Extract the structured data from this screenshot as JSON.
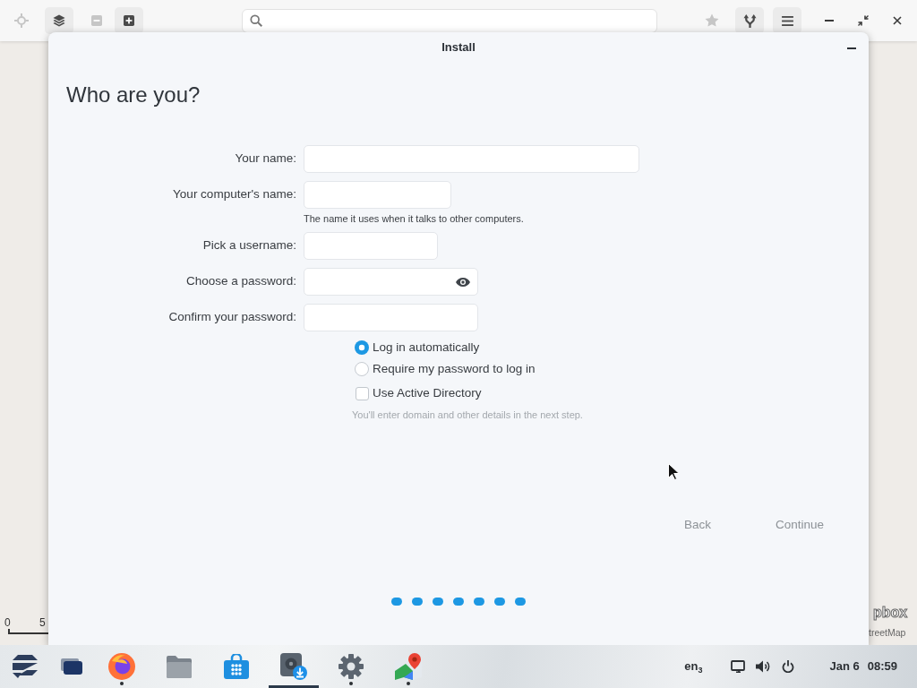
{
  "map_toolbar": {
    "left_buttons": [
      {
        "kind": "locate",
        "disabled": true
      },
      {
        "kind": "layers",
        "disabled": false
      },
      {
        "kind": "zoom-out",
        "disabled": true
      },
      {
        "kind": "zoom-in",
        "disabled": false
      }
    ],
    "right_buttons": [
      {
        "kind": "favorite",
        "disabled": true
      },
      {
        "kind": "route",
        "disabled": false
      },
      {
        "kind": "menu",
        "disabled": false
      }
    ]
  },
  "map": {
    "scale_labels": [
      "0",
      "5"
    ],
    "attribution_logo": "pbox",
    "attribution_text": "treetMap"
  },
  "dialog": {
    "title": "Install",
    "heading": "Who are you?",
    "fields": [
      {
        "label": "Your name:"
      },
      {
        "label": "Your computer's name:",
        "hint": "The name it uses when it talks to other computers."
      },
      {
        "label": "Pick a username:"
      },
      {
        "label": "Choose a password:",
        "reveal_button": true
      },
      {
        "label": "Confirm your password:"
      }
    ],
    "login_options": [
      {
        "kind": "radio",
        "label": "Log in automatically",
        "selected": true
      },
      {
        "kind": "radio",
        "label": "Require my password to log in",
        "selected": false
      },
      {
        "kind": "checkbox",
        "label": "Use Active Directory",
        "checked": false
      }
    ],
    "note": "You'll enter domain and other details in the next step.",
    "buttons": [
      {
        "label": "Back",
        "disabled": true
      },
      {
        "label": "Continue",
        "disabled": true
      }
    ],
    "progress_dots": [
      {
        "done": true
      },
      {
        "done": true
      },
      {
        "done": true
      },
      {
        "done": true
      },
      {
        "done": true
      },
      {
        "done": true
      },
      {
        "done": true
      }
    ]
  },
  "taskbar": {
    "apps": [
      {
        "kind": "browser",
        "running": true,
        "selected": false
      },
      {
        "kind": "files",
        "running": false,
        "selected": false
      },
      {
        "kind": "store",
        "running": false,
        "selected": false
      },
      {
        "kind": "installer",
        "running": true,
        "selected": true
      },
      {
        "kind": "settings",
        "running": true,
        "selected": false
      },
      {
        "kind": "maps",
        "running": true,
        "selected": false
      }
    ],
    "keyboard_layout": "en$_{3}$",
    "date": "Jan 6",
    "time": "08:59"
  }
}
